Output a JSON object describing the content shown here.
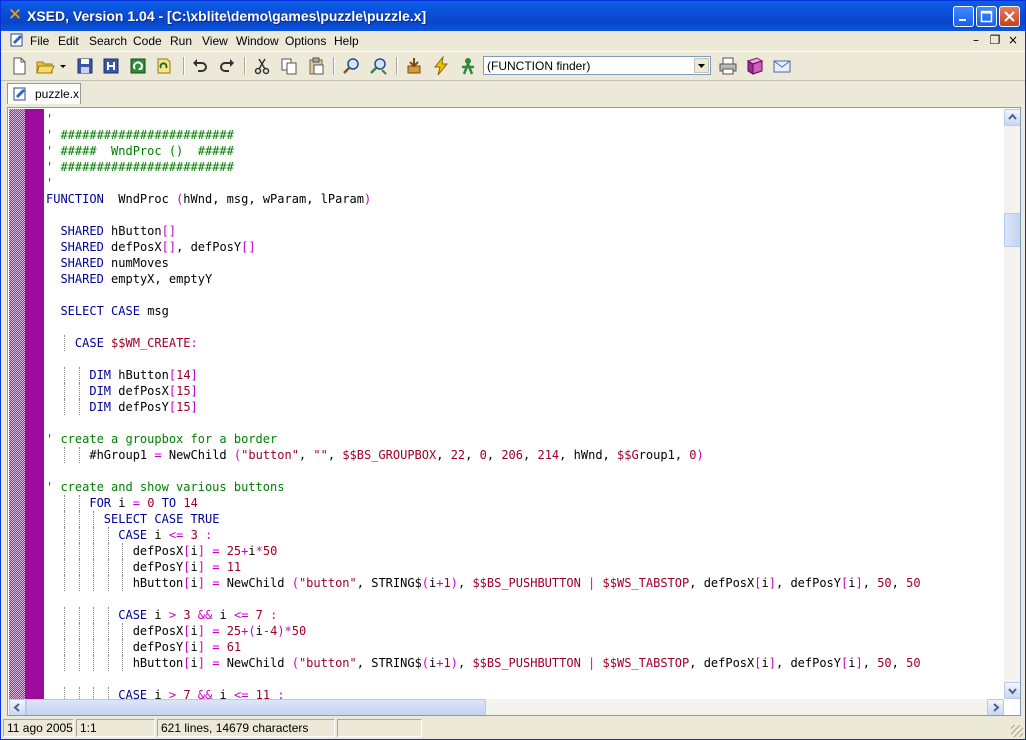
{
  "window": {
    "title": "XSED, Version 1.04 - [C:\\xblite\\demo\\games\\puzzle\\puzzle.x]"
  },
  "menu": {
    "items": [
      "File",
      "Edit",
      "Search",
      "Code",
      "Run",
      "View",
      "Window",
      "Options",
      "Help"
    ]
  },
  "toolbar": {
    "buttons": [
      "new-file-icon",
      "open-file-icon",
      "dropdown-arrow-icon",
      "save-icon",
      "save-all-icon",
      "refresh-icon",
      "reload-icon",
      "undo-icon",
      "redo-icon",
      "cut-icon",
      "copy-icon",
      "paste-icon",
      "find-icon",
      "find-replace-icon",
      "compile-icon",
      "run-icon",
      "build-icon",
      "print-icon",
      "help-book-icon",
      "email-icon"
    ],
    "function_finder": "(FUNCTION finder)"
  },
  "tabs": [
    {
      "label": "puzzle.x"
    }
  ],
  "editor": {
    "lines": [
      "'",
      "' ########################",
      "' #####  WndProc ()  #####",
      "' ########################",
      "'",
      "FUNCTION  WndProc (hWnd, msg, wParam, lParam)",
      "",
      "  SHARED hButton[]",
      "  SHARED defPosX[], defPosY[]",
      "  SHARED numMoves",
      "  SHARED emptyX, emptyY",
      "",
      "  SELECT CASE msg",
      "",
      "    CASE $$WM_CREATE:",
      "",
      "      DIM hButton[14]",
      "      DIM defPosX[15]",
      "      DIM defPosY[15]",
      "",
      "' create a groupbox for a border",
      "      #hGroup1 = NewChild (\"button\", \"\", $$BS_GROUPBOX, 22, 0, 206, 214, hWnd, $$Group1, 0)",
      "",
      "' create and show various buttons",
      "      FOR i = 0 TO 14",
      "        SELECT CASE TRUE",
      "          CASE i <= 3 :",
      "            defPosX[i] = 25+i*50",
      "            defPosY[i] = 11",
      "            hButton[i] = NewChild (\"button\", STRING$(i+1), $$BS_PUSHBUTTON | $$WS_TABSTOP, defPosX[i], defPosY[i], 50, 50",
      "",
      "          CASE i > 3 && i <= 7 :",
      "            defPosX[i] = 25+(i-4)*50",
      "            defPosY[i] = 61",
      "            hButton[i] = NewChild (\"button\", STRING$(i+1), $$BS_PUSHBUTTON | $$WS_TABSTOP, defPosX[i], defPosY[i], 50, 50",
      "",
      "          CASE i > 7 && i <= 11 :"
    ]
  },
  "status": {
    "date": "11 ago 2005",
    "position": "1:1",
    "info": "621 lines, 14679 characters",
    "extra": ""
  },
  "colors": {
    "comment": "#008000",
    "keyword": "#000099",
    "string": "#a00028",
    "symbol": "#cc00cc",
    "gutter": "#9c0b9c"
  }
}
